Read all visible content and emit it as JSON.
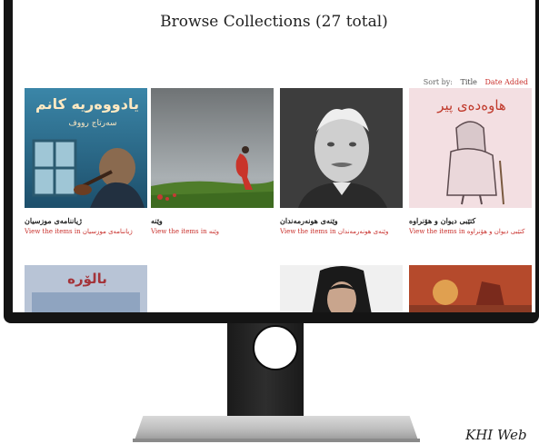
{
  "site": {
    "page_title": "Browse Collections (27 total)",
    "sort": {
      "label": "Sort by:",
      "options": [
        "Title",
        "Date Added"
      ],
      "active": "Date Added"
    }
  },
  "collections": [
    {
      "title": "ژیاننامەی موزسیان",
      "link_text": "View the items in ژیاننامەی موزسیان",
      "thumb_text": [
        "یادووەریە کانم",
        "سەرتاج رووف"
      ]
    },
    {
      "title": "وێنە",
      "link_text": "View the items in وێنە"
    },
    {
      "title": "وێنەی هونەرمەندان",
      "link_text": "View the items in وێنەی هونەرمەندان"
    },
    {
      "title": "کتێبی دیوان و هۆنراوە",
      "link_text": "View the items in کتێبی دیوان و هۆنراوە",
      "thumb_text": [
        "هاوەدەی پیر"
      ]
    }
  ],
  "row2": {
    "thumb_text": [
      "بالۆرە"
    ]
  },
  "caption": "KHI Web"
}
